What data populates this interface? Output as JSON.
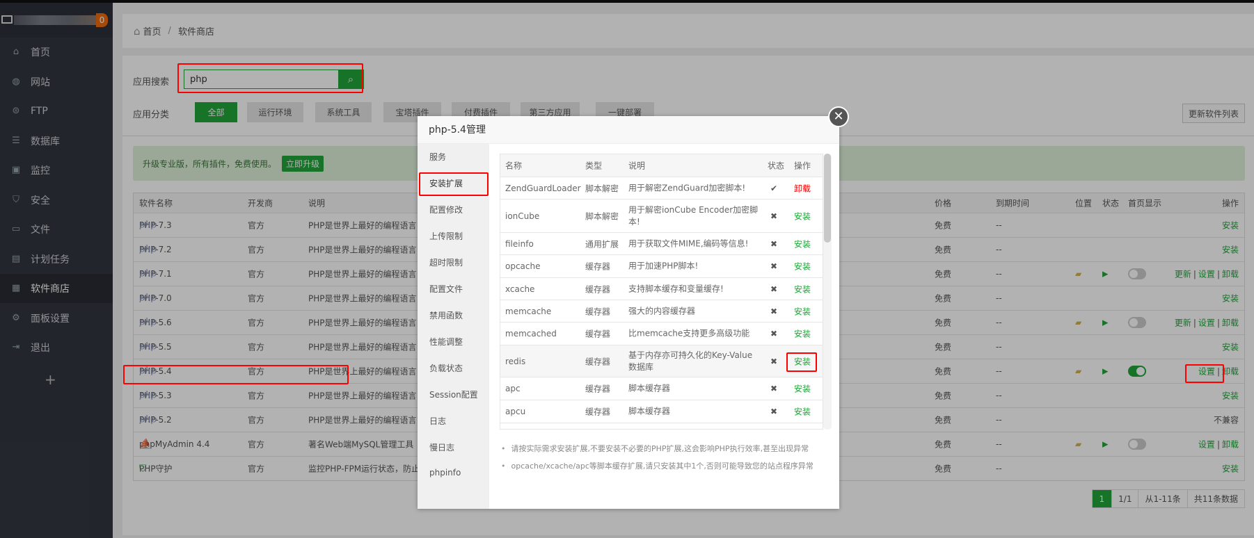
{
  "sidebar": {
    "badge": "0",
    "items": [
      {
        "label": "首页",
        "icon": "home-icon",
        "glyph": "⌂"
      },
      {
        "label": "网站",
        "icon": "globe-icon",
        "glyph": "◍"
      },
      {
        "label": "FTP",
        "icon": "ftp-icon",
        "glyph": "⊜"
      },
      {
        "label": "数据库",
        "icon": "database-icon",
        "glyph": "☰"
      },
      {
        "label": "监控",
        "icon": "monitor-chart-icon",
        "glyph": "▣"
      },
      {
        "label": "安全",
        "icon": "shield-icon",
        "glyph": "⛉"
      },
      {
        "label": "文件",
        "icon": "folder-icon",
        "glyph": "▭"
      },
      {
        "label": "计划任务",
        "icon": "calendar-icon",
        "glyph": "▤"
      },
      {
        "label": "软件商店",
        "icon": "grid-icon",
        "glyph": "▦",
        "active": true
      },
      {
        "label": "面板设置",
        "icon": "gear-icon",
        "glyph": "⚙"
      },
      {
        "label": "退出",
        "icon": "logout-icon",
        "glyph": "⇥"
      }
    ],
    "add": "+"
  },
  "breadcrumb": {
    "home": "首页",
    "sep": "/",
    "current": "软件商店"
  },
  "search": {
    "label": "应用搜索",
    "value": "php"
  },
  "categories": {
    "label": "应用分类",
    "items": [
      "全部",
      "运行环境",
      "系统工具",
      "宝塔插件",
      "付费插件",
      "第三方应用",
      "一键部署"
    ],
    "update_button": "更新软件列表"
  },
  "banner": {
    "text": "升级专业版，所有插件，免费使用。",
    "button": "立即升级"
  },
  "table": {
    "headers": [
      "软件名称",
      "开发商",
      "说明",
      "价格",
      "到期时间",
      "位置",
      "状态",
      "首页显示",
      "操作"
    ],
    "rows": [
      {
        "name": "PHP-7.3",
        "icon": "php",
        "dev": "官方",
        "desc": "PHP是世界上最好的编程语言",
        "price": "免费",
        "expire": "--",
        "ops": [
          "安装"
        ]
      },
      {
        "name": "PHP-7.2",
        "icon": "php",
        "dev": "官方",
        "desc": "PHP是世界上最好的编程语言",
        "price": "免费",
        "expire": "--",
        "ops": [
          "安装"
        ]
      },
      {
        "name": "PHP-7.1",
        "icon": "php",
        "dev": "官方",
        "desc": "PHP是世界上最好的编程语言",
        "price": "免费",
        "expire": "--",
        "installed": true,
        "home": false,
        "ops": [
          "更新",
          "设置",
          "卸载"
        ]
      },
      {
        "name": "PHP-7.0",
        "icon": "php",
        "dev": "官方",
        "desc": "PHP是世界上最好的编程语言",
        "price": "免费",
        "expire": "--",
        "ops": [
          "安装"
        ]
      },
      {
        "name": "PHP-5.6",
        "icon": "php",
        "dev": "官方",
        "desc": "PHP是世界上最好的编程语言",
        "price": "免费",
        "expire": "--",
        "installed": true,
        "home": false,
        "ops": [
          "更新",
          "设置",
          "卸载"
        ]
      },
      {
        "name": "PHP-5.5",
        "icon": "php",
        "dev": "官方",
        "desc": "PHP是世界上最好的编程语言",
        "price": "免费",
        "expire": "--",
        "ops": [
          "安装"
        ]
      },
      {
        "name": "PHP-5.4",
        "icon": "php",
        "dev": "官方",
        "desc": "PHP是世界上最好的编程语言",
        "price": "免费",
        "expire": "--",
        "installed": true,
        "home": true,
        "ops": [
          "设置",
          "卸载"
        ]
      },
      {
        "name": "PHP-5.3",
        "icon": "php",
        "dev": "官方",
        "desc": "PHP是世界上最好的编程语言",
        "price": "免费",
        "expire": "--",
        "ops": [
          "安装"
        ]
      },
      {
        "name": "PHP-5.2",
        "icon": "php",
        "dev": "官方",
        "desc": "PHP是世界上最好的编程语言",
        "price": "免费",
        "expire": "--",
        "ops": [],
        "status_text": "不兼容"
      },
      {
        "name": "phpMyAdmin 4.4",
        "icon": "phpmyadmin",
        "dev": "官方",
        "desc": "著名Web端MySQL管理工具",
        "price": "免费",
        "expire": "--",
        "installed": true,
        "home": false,
        "ops": [
          "设置",
          "卸载"
        ]
      },
      {
        "name": "PHP守护",
        "icon": "php-guard",
        "dev": "官方",
        "desc": "监控PHP-FPM运行状态，防止大",
        "price": "免费",
        "expire": "--",
        "ops": [
          "安装"
        ]
      }
    ]
  },
  "pager": {
    "current": "1",
    "pages": "1/1",
    "range": "从1-11条",
    "total": "共11条数据"
  },
  "modal": {
    "title": "php-5.4管理",
    "nav": [
      "服务",
      "安装扩展",
      "配置修改",
      "上传限制",
      "超时限制",
      "配置文件",
      "禁用函数",
      "性能调整",
      "负载状态",
      "Session配置",
      "日志",
      "慢日志",
      "phpinfo"
    ],
    "headers": [
      "名称",
      "类型",
      "说明",
      "状态",
      "操作"
    ],
    "rows": [
      {
        "name": "ZendGuardLoader",
        "type": "脚本解密",
        "desc": "用于解密ZendGuard加密脚本!",
        "installed": true,
        "op": "卸载"
      },
      {
        "name": "ionCube",
        "type": "脚本解密",
        "desc": "用于解密ionCube Encoder加密脚本!",
        "installed": false,
        "op": "安装"
      },
      {
        "name": "fileinfo",
        "type": "通用扩展",
        "desc": "用于获取文件MIME,编码等信息!",
        "installed": false,
        "op": "安装"
      },
      {
        "name": "opcache",
        "type": "缓存器",
        "desc": "用于加速PHP脚本!",
        "installed": false,
        "op": "安装"
      },
      {
        "name": "xcache",
        "type": "缓存器",
        "desc": "支持脚本缓存和变量缓存!",
        "installed": false,
        "op": "安装"
      },
      {
        "name": "memcache",
        "type": "缓存器",
        "desc": "强大的内容缓存器",
        "installed": false,
        "op": "安装"
      },
      {
        "name": "memcached",
        "type": "缓存器",
        "desc": "比memcache支持更多高级功能",
        "installed": false,
        "op": "安装"
      },
      {
        "name": "redis",
        "type": "缓存器",
        "desc": "基于内存亦可持久化的Key-Value数据库",
        "installed": false,
        "op": "安装"
      },
      {
        "name": "apc",
        "type": "缓存器",
        "desc": "脚本缓存器",
        "installed": false,
        "op": "安装"
      },
      {
        "name": "apcu",
        "type": "缓存器",
        "desc": "脚本缓存器",
        "installed": false,
        "op": "安装"
      }
    ],
    "notes": [
      "请按实际需求安装扩展,不要安装不必要的PHP扩展,这会影响PHP执行效率,甚至出现异常",
      "opcache/xcache/apc等脚本缓存扩展,请只安装其中1个,否则可能导致您的站点程序异常"
    ]
  },
  "colors": {
    "accent": "#20a53a",
    "danger": "#ff0000",
    "highlight": "#ff0000",
    "sidebar": "#323640"
  }
}
